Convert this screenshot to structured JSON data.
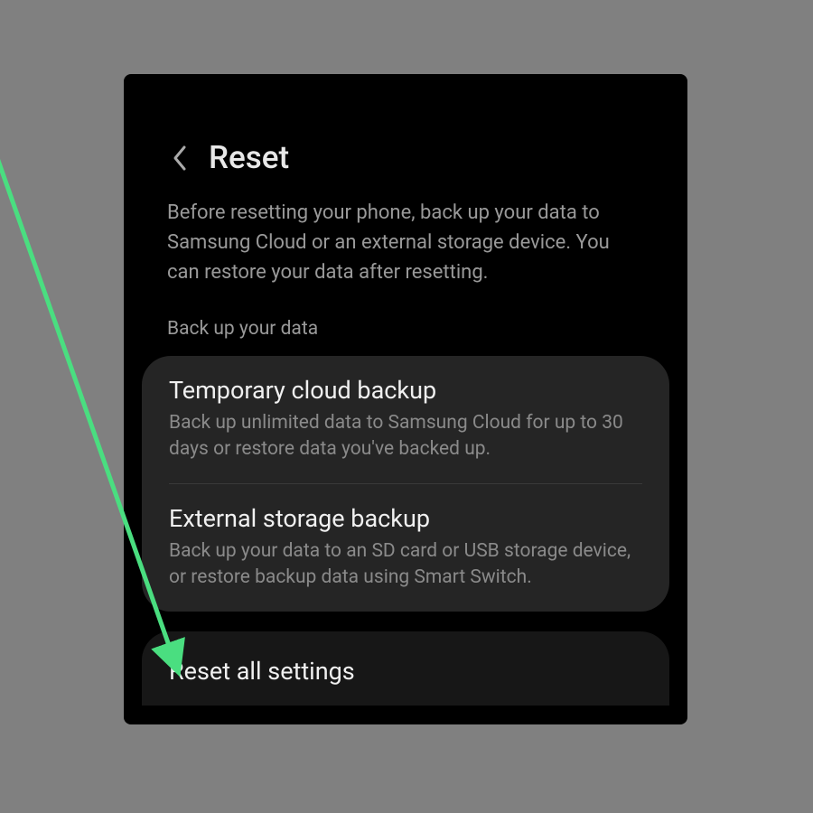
{
  "header": {
    "title": "Reset"
  },
  "description": "Before resetting your phone, back up your data to Samsung Cloud or an external storage device. You can restore your data after resetting.",
  "section_header": "Back up your data",
  "backup_options": [
    {
      "title": "Temporary cloud backup",
      "description": "Back up unlimited data to Samsung Cloud for up to 30 days or restore data you've backed up."
    },
    {
      "title": "External storage backup",
      "description": "Back up your data to an SD card or USB storage device, or restore backup data using Smart Switch."
    }
  ],
  "reset_options": [
    {
      "title": "Reset all settings"
    }
  ],
  "annotation": {
    "arrow_color": "#4ade80"
  }
}
